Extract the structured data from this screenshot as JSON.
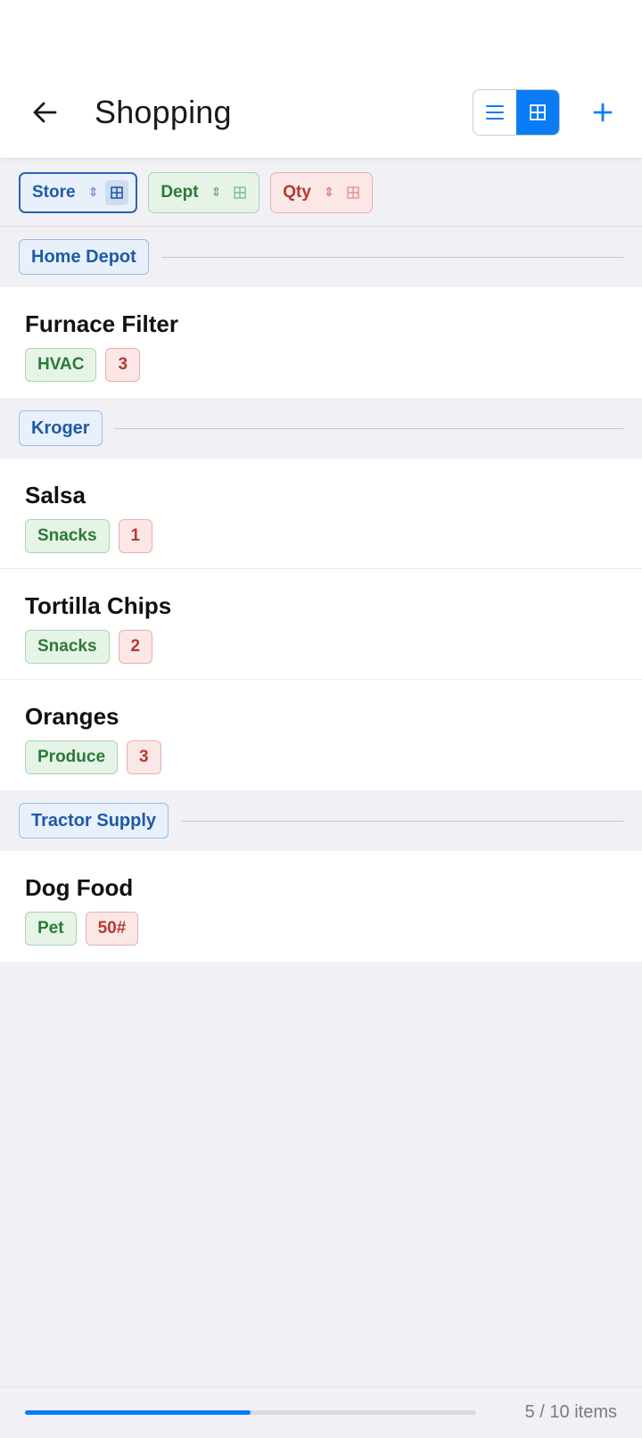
{
  "header": {
    "title": "Shopping",
    "back_icon": "arrow-left-icon",
    "view_list_icon": "list-icon",
    "view_grid_icon": "grid-icon",
    "add_icon": "plus-icon",
    "active_view": "grid"
  },
  "filters": [
    {
      "label": "Store",
      "active": true
    },
    {
      "label": "Dept",
      "active": false
    },
    {
      "label": "Qty",
      "active": false
    }
  ],
  "groups": [
    {
      "store": "Home Depot",
      "items": [
        {
          "name": "Furnace Filter",
          "dept": "HVAC",
          "qty": "3"
        }
      ]
    },
    {
      "store": "Kroger",
      "items": [
        {
          "name": "Salsa",
          "dept": "Snacks",
          "qty": "1"
        },
        {
          "name": "Tortilla Chips",
          "dept": "Snacks",
          "qty": "2"
        },
        {
          "name": "Oranges",
          "dept": "Produce",
          "qty": "3"
        }
      ]
    },
    {
      "store": "Tractor Supply",
      "items": [
        {
          "name": "Dog Food",
          "dept": "Pet",
          "qty": "50#"
        }
      ]
    }
  ],
  "footer": {
    "progress": 0.5,
    "count_text": "5 / 10 items"
  },
  "colors": {
    "accent": "#0a7cf5",
    "store": "#1f5aa6",
    "dept": "#2b7a35",
    "qty": "#b43a32"
  }
}
